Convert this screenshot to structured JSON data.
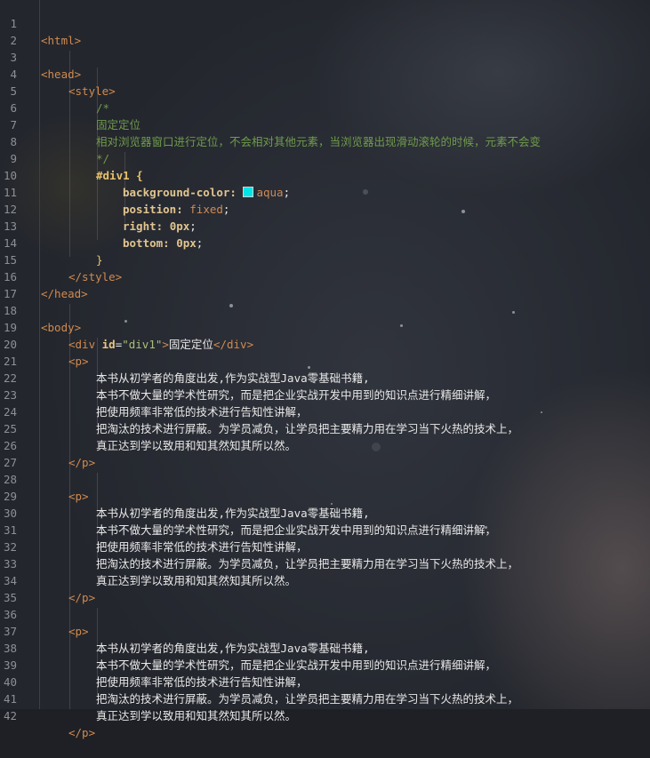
{
  "editor": {
    "line_numbers": [
      "1",
      "2",
      "3",
      "4",
      "5",
      "6",
      "7",
      "8",
      "9",
      "10",
      "11",
      "12",
      "13",
      "14",
      "15",
      "16",
      "17",
      "18",
      "19",
      "20",
      "21",
      "22",
      "23",
      "24",
      "25",
      "26",
      "27",
      "28",
      "29",
      "30",
      "31",
      "32",
      "33",
      "34",
      "35",
      "36",
      "37",
      "38",
      "39",
      "40",
      "41",
      "42"
    ],
    "tokens": {
      "html_open": "<html>",
      "head_open": "<head>",
      "style_open": "<style>",
      "comment_open": "/*",
      "comment_title": "固定定位",
      "comment_desc": "相对浏览器窗口进行定位，不会相对其他元素，当浏览器出现滑动滚轮的时候，元素不会变",
      "comment_close": "*/",
      "selector": "#div1 {",
      "prop_bg": "background-color: ",
      "val_bg": "aqua",
      "semi": ";",
      "prop_pos": "position: ",
      "val_pos": "fixed",
      "prop_right": "right: ",
      "val_right": "0px",
      "prop_bottom": "bottom: ",
      "val_bottom": "0px",
      "brace_close": "}",
      "style_close": "</style>",
      "head_close": "</head>",
      "body_open": "<body>",
      "div_open_pre": "<div ",
      "div_attr": "id",
      "div_eq": "=",
      "div_val": "\"div1\"",
      "div_gt": ">",
      "div_text": "固定定位",
      "div_close": "</div>",
      "p_open": "<p>",
      "p_close": "</p>",
      "p_line1": "本书从初学者的角度出发,作为实战型Java零基础书籍,",
      "p_line2": "本书不做大量的学术性研究，而是把企业实战开发中用到的知识点进行精细讲解，",
      "p_line3": "把使用频率非常低的技术进行告知性讲解，",
      "p_line4": "把淘汰的技术进行屏蔽。为学员减负，让学员把主要精力用在学习当下火热的技术上，",
      "p_line5": "真正达到学以致用和知其然知其所以然。"
    },
    "colors": {
      "tag": "#d08a4f",
      "comment": "#6f9a4c",
      "selector": "#e7c16d",
      "property": "#e2c58f",
      "value": "#cf8a57",
      "string": "#a8c07a",
      "swatch": "#00e5e5"
    }
  }
}
